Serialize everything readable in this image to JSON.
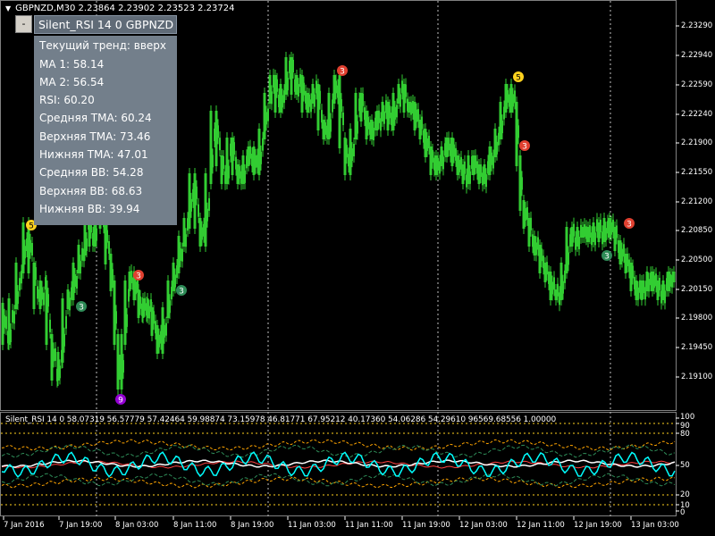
{
  "chart_title": "GBPNZD,M30  2.23864 2.23902 2.23523 2.23724",
  "indicator_button": "-",
  "indicator_label": "Silent_RSI 14 0 GBPNZD",
  "info_panel": {
    "lines": [
      "Текущий тренд: вверх",
      "MA 1: 58.14",
      "MA 2: 56.54",
      "RSI: 60.20",
      "Средняя TMA: 60.24",
      "Верхняя TMA: 73.46",
      "Нижняя TMA: 47.01",
      "Средняя BB: 54.28",
      "Верхняя BB: 68.63",
      "Нижняя BB: 39.94"
    ]
  },
  "indicator_subtitle": "Silent_RSI 14 0 58.07319 56.57779 57.42464 59.98874 73.15978 46.81771 67.95212 40.17360 54.06286 54.29610 96569.68556 1.00000",
  "price_axis": [
    "2.23290",
    "2.22940",
    "2.22590",
    "2.22240",
    "2.21900",
    "2.21550",
    "2.21200",
    "2.20850",
    "2.20500",
    "2.20150",
    "2.19800",
    "2.19450",
    "2.19100"
  ],
  "indicator_axis": [
    "100",
    "90",
    "80",
    "50",
    "20",
    "10",
    "0"
  ],
  "time_axis": [
    "7 Jan 2016",
    "7 Jan 19:00",
    "8 Jan 03:00",
    "8 Jan 11:00",
    "8 Jan 19:00",
    "11 Jan 03:00",
    "11 Jan 11:00",
    "11 Jan 19:00",
    "12 Jan 03:00",
    "12 Jan 11:00",
    "12 Jan 19:00",
    "13 Jan 03:00"
  ],
  "signals": [
    {
      "label": "5",
      "kind": "gold"
    },
    {
      "label": "3",
      "kind": "green"
    },
    {
      "label": "9",
      "kind": "purple"
    },
    {
      "label": "3",
      "kind": "red"
    },
    {
      "label": "3",
      "kind": "green"
    },
    {
      "label": "3",
      "kind": "red"
    },
    {
      "label": "5",
      "kind": "gold"
    },
    {
      "label": "3",
      "kind": "red"
    },
    {
      "label": "3",
      "kind": "green"
    },
    {
      "label": "3",
      "kind": "red"
    }
  ],
  "colors": {
    "background": "#000000",
    "candle": "#32cd32",
    "grid": "#c0c0c0",
    "rsi": "#00ffff",
    "ma1": "#ffffff",
    "ma2": "#ff4040",
    "tma_upper": "#ffa500",
    "tma_lower": "#ffa500",
    "bb": "#2e8b57",
    "signal_gold": "#ffd21e",
    "signal_green": "#2e8b57",
    "signal_red": "#e04030",
    "signal_purple": "#9400d3"
  }
}
